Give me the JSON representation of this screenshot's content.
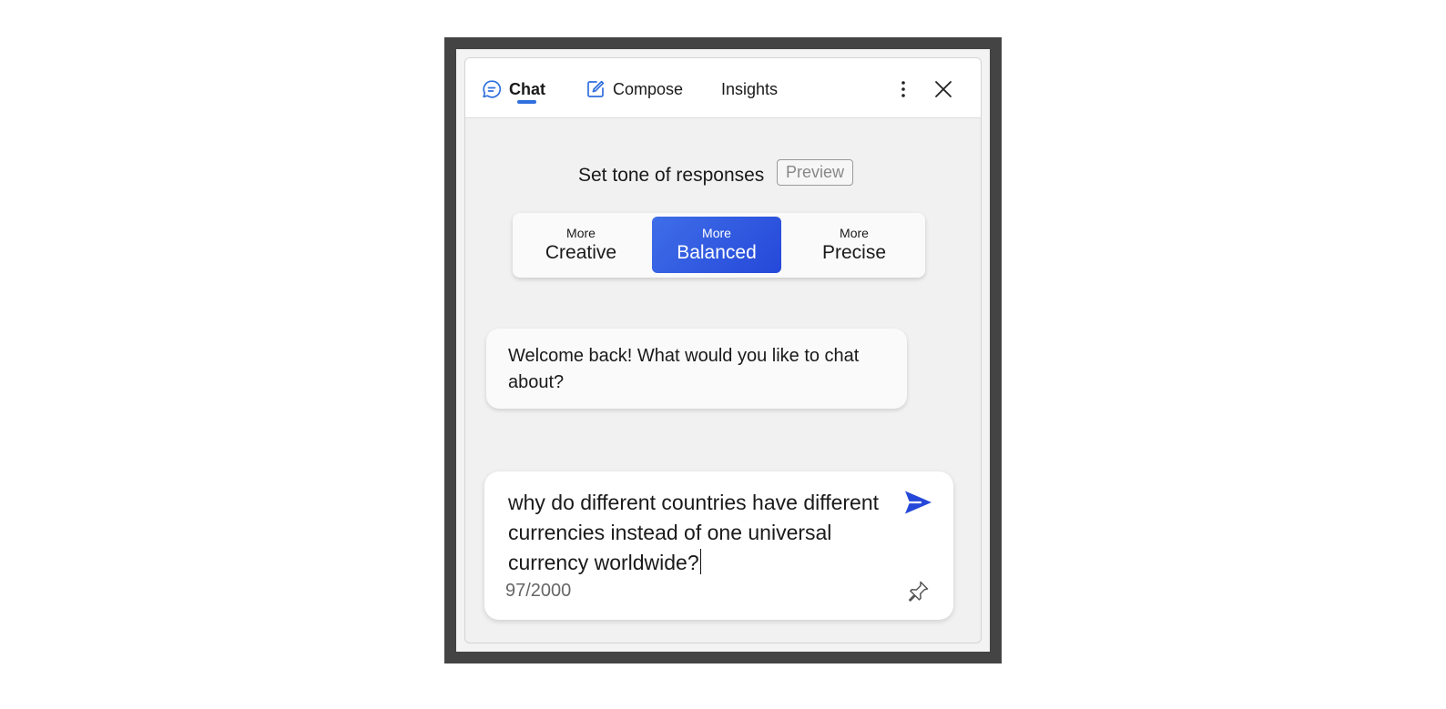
{
  "header": {
    "tabs": [
      {
        "label": "Chat",
        "icon": "chat-bubble-icon",
        "active": true
      },
      {
        "label": "Compose",
        "icon": "compose-icon",
        "active": false
      },
      {
        "label": "Insights",
        "active": false
      }
    ],
    "more_icon": "more-vertical-icon",
    "close_icon": "close-icon"
  },
  "tone": {
    "label": "Set tone of responses",
    "badge": "Preview",
    "options": [
      {
        "small": "More",
        "big": "Creative",
        "selected": false
      },
      {
        "small": "More",
        "big": "Balanced",
        "selected": true
      },
      {
        "small": "More",
        "big": "Precise",
        "selected": false
      }
    ]
  },
  "chat": {
    "welcome": "Welcome back! What would you like to chat about?"
  },
  "composer": {
    "value": "why do different countries have different currencies instead of one universal currency worldwide?",
    "counter": "97/2000",
    "send_icon": "send-icon",
    "pin_icon": "pin-icon"
  },
  "colors": {
    "accent": "#2f6fde",
    "selected_gradient_start": "#3f6ee8",
    "selected_gradient_end": "#2548d9",
    "send": "#2548d9"
  }
}
